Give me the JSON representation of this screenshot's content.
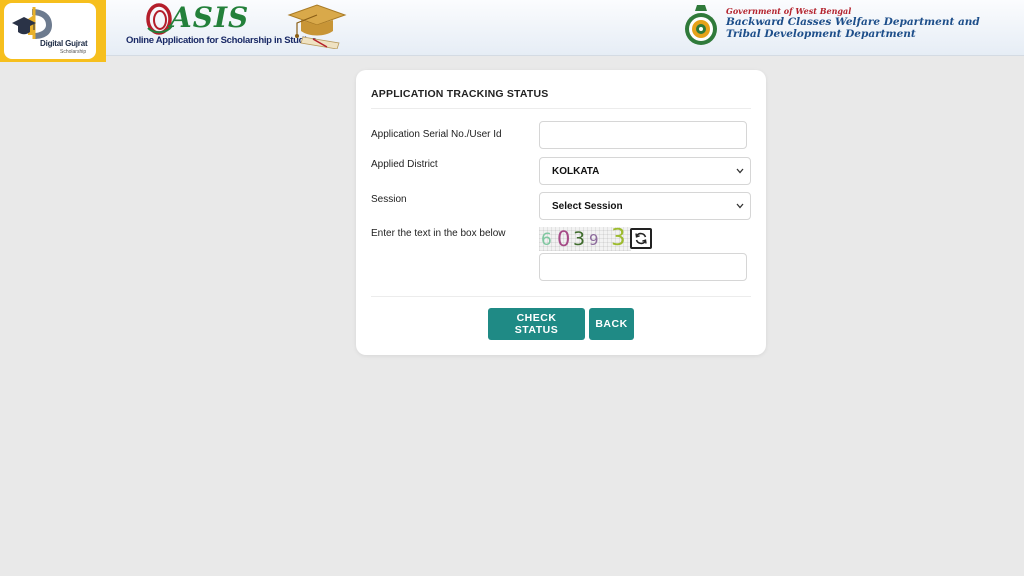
{
  "header": {
    "digital_gujarat": {
      "title": "Digital Gujrat",
      "subtitle": "Scholarship"
    },
    "oasis": {
      "word": "ASIS",
      "tagline": "Online Application for Scholarship in Studies"
    },
    "government": "Government of West Bengal",
    "department_line1": "Backward Classes Welfare Department and",
    "department_line2": "Tribal Development Department"
  },
  "form": {
    "title": "APPLICATION TRACKING STATUS",
    "serial_label": "Application Serial No./User Id",
    "serial_value": "",
    "district_label": "Applied District",
    "district_value": "KOLKATA",
    "session_label": "Session",
    "session_value": "Select Session",
    "captcha_label": "Enter the text in the box below",
    "captcha_chars": [
      "6",
      "0",
      "3",
      "9",
      "3"
    ],
    "captcha_value": "",
    "check_status_label": "CHECK STATUS",
    "back_label": "BACK"
  },
  "icons": {
    "captcha_refresh": "refresh-icon",
    "select_arrow": "chevron-down-icon",
    "emblem": "emblem-icon"
  },
  "colors": {
    "accent_button": "#1f8a85",
    "header_badge": "#f6bf1d",
    "oasis_green": "#23803a",
    "department_blue": "#1d4e8a",
    "government_red": "#b4232d",
    "page_background": "#e9e9e9"
  }
}
